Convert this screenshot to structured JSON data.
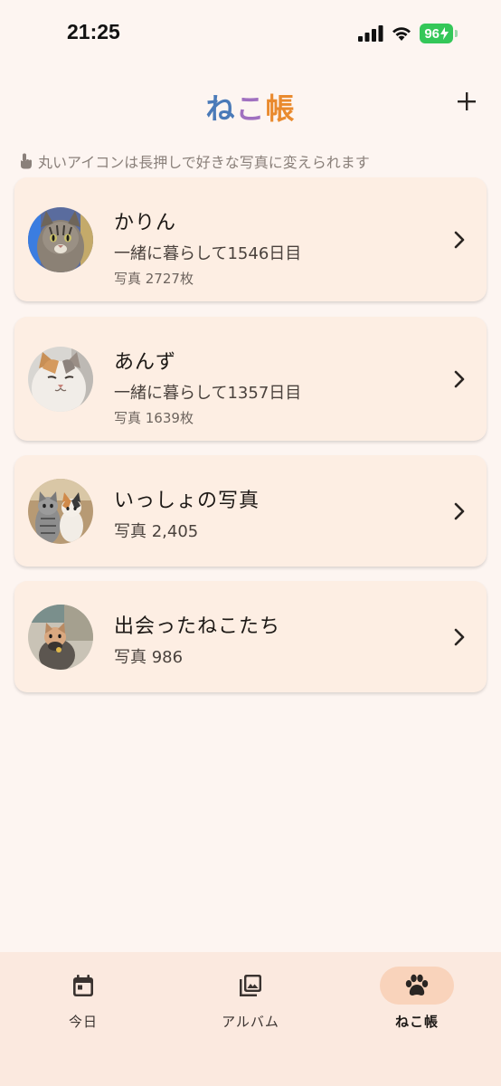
{
  "status_bar": {
    "time": "21:25",
    "battery": "96"
  },
  "header": {
    "title_parts": [
      "ね",
      "こ",
      "帳"
    ],
    "add_label": "+"
  },
  "hint": {
    "text": "丸いアイコンは長押しで好きな写真に変えられます"
  },
  "cards": [
    {
      "name": "かりん",
      "subtitle": "一緒に暮らして1546日目",
      "photos": "写真 2727枚"
    },
    {
      "name": "あんず",
      "subtitle": "一緒に暮らして1357日目",
      "photos": "写真 1639枚"
    },
    {
      "name": "いっしょの写真",
      "photos": "写真 2,405"
    },
    {
      "name": "出会ったねこたち",
      "photos": "写真 986"
    }
  ],
  "tabs": [
    {
      "label": "今日",
      "icon": "calendar-icon"
    },
    {
      "label": "アルバム",
      "icon": "photo-album-icon"
    },
    {
      "label": "ねこ帳",
      "icon": "paw-icon",
      "active": true
    }
  ],
  "colors": {
    "background": "#fdf5f1",
    "card": "#fdeee3",
    "tab_bar": "#fbe9df",
    "active_tab_pill": "#f9d3bb",
    "title_ne": "#4a7ab8",
    "title_ko": "#a070c0",
    "title_chou": "#e98a2e"
  }
}
